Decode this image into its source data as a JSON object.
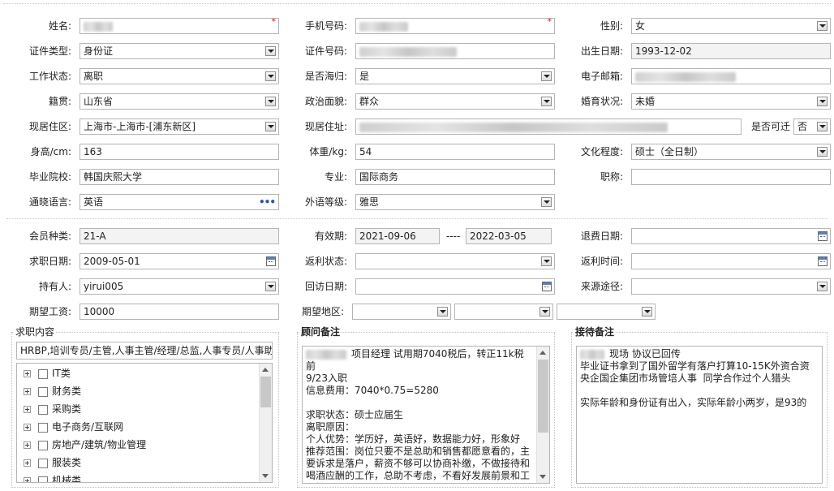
{
  "personal": {
    "name_label": "姓名:",
    "phone_label": "手机号码:",
    "gender_label": "性别:",
    "gender": "女",
    "idtype_label": "证件类型:",
    "idtype": "身份证",
    "idno_label": "证件号码:",
    "birth_label": "出生日期:",
    "birth": "1993-12-02",
    "workstatus_label": "工作状态:",
    "workstatus": "离职",
    "overseas_label": "是否海归:",
    "overseas": "是",
    "email_label": "电子邮箱:",
    "native_label": "籍贯:",
    "native": "山东省",
    "political_label": "政治面貌:",
    "political": "群众",
    "marital_label": "婚育状况:",
    "marital": "未婚",
    "residence_area_label": "现居住区:",
    "residence_area": "上海市-上海市-[浦东新区]",
    "address_label": "现居住址:",
    "relocate_label": "是否可迁",
    "relocate": "否",
    "height_label": "身高/cm:",
    "height": "163",
    "weight_label": "体重/kg:",
    "weight": "54",
    "education_label": "文化程度:",
    "education": "硕士（全日制）",
    "school_label": "毕业院校:",
    "school": "韩国庆熙大学",
    "major_label": "专业:",
    "major": "国际商务",
    "title_label": "职称:",
    "title": "",
    "language_label": "通晓语言:",
    "language": "英语",
    "foreign_level_label": "外语等级:",
    "foreign_level": "雅思"
  },
  "membership": {
    "type_label": "会员种类:",
    "type": "21-A",
    "valid_label": "有效期:",
    "valid_from": "2021-09-06",
    "valid_sep": "----",
    "valid_to": "2022-03-05",
    "refund_date_label": "退费日期:",
    "jobdate_label": "求职日期:",
    "jobdate": "2009-05-01",
    "rebate_status_label": "返利状态:",
    "rebate_time_label": "返利时间:",
    "holder_label": "持有人:",
    "holder": "yirui005",
    "visit_date_label": "回访日期:",
    "source_label": "来源途径:",
    "salary_label": "期望工资:",
    "salary": "10000",
    "region_label": "期望地区:"
  },
  "job_content": {
    "legend": "求职内容",
    "positions": "HRBP,培训专员/主管,人事主管/经理/总监,人事专员/人事助",
    "tree": [
      "IT类",
      "财务类",
      "采购类",
      "电子商务/互联网",
      "房地产/建筑/物业管理",
      "服装类",
      "机械类"
    ]
  },
  "advisor_notes": {
    "legend": "顾问备注",
    "text": "项目经理 试用期7040税后，转正11k税前\n9/23入职\n信息费用：7040*0.75=5280\n\n求职状态：硕士应届生\n离职原因：\n个人优势：学历好，英语好，数据能力好，形象好\n推荐范围：岗位只要不是总助和销售都愿意看的，主要诉求是落户，薪资不够可以协商补缴，不做接待和喝酒应酬的工作，总助不考虑，不看好发展前景和工作性质"
  },
  "reception_notes": {
    "legend": "接待备注",
    "text": "现场 协议已回传\n毕业证书拿到了国外留学有落户打算10-15K外资合资央企国企集团市场管培人事  同学合作过个人猎头\n\n实际年龄和身份证有出入，实际年龄小两岁，是93的"
  }
}
